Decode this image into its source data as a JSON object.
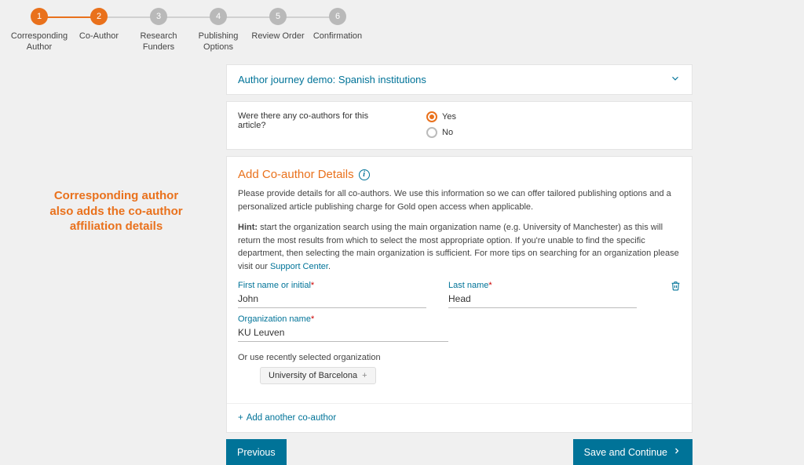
{
  "stepper": [
    {
      "num": "1",
      "label": "Corresponding Author",
      "state": "done"
    },
    {
      "num": "2",
      "label": "Co-Author",
      "state": "current"
    },
    {
      "num": "3",
      "label": "Research Funders",
      "state": "todo"
    },
    {
      "num": "4",
      "label": "Publishing Options",
      "state": "todo"
    },
    {
      "num": "5",
      "label": "Review Order",
      "state": "todo"
    },
    {
      "num": "6",
      "label": "Confirmation",
      "state": "todo"
    }
  ],
  "callout": "Corresponding author also adds the co-author affiliation details",
  "journey": {
    "title": "Author journey demo: Spanish institutions"
  },
  "coauthor_q": {
    "question": "Were there any co-authors for this article?",
    "options": {
      "yes": "Yes",
      "no": "No"
    },
    "selected": "yes"
  },
  "details": {
    "heading": "Add Co-author Details",
    "intro": "Please provide details for all co-authors. We use this information so we can offer tailored publishing options and a personalized article publishing charge for Gold open access when applicable.",
    "hint_label": "Hint:",
    "hint_text": " start the organization search using the main organization name (e.g. University of Manchester) as this will return the most results from which to select the most appropriate option. If you're unable to find the specific department, then selecting the main organization is sufficient. For more tips on searching for an organization please visit our ",
    "hint_link": "Support Center",
    "hint_after": "."
  },
  "fields": {
    "first_name": {
      "label": "First name or initial",
      "value": "John"
    },
    "last_name": {
      "label": "Last name",
      "value": "Head"
    },
    "org_name": {
      "label": "Organization name",
      "value": "KU Leuven"
    }
  },
  "recent": {
    "label": "Or use recently selected organization",
    "chip": "University of Barcelona"
  },
  "add_link": "Add another co-author",
  "buttons": {
    "prev": "Previous",
    "next": "Save and Continue"
  }
}
